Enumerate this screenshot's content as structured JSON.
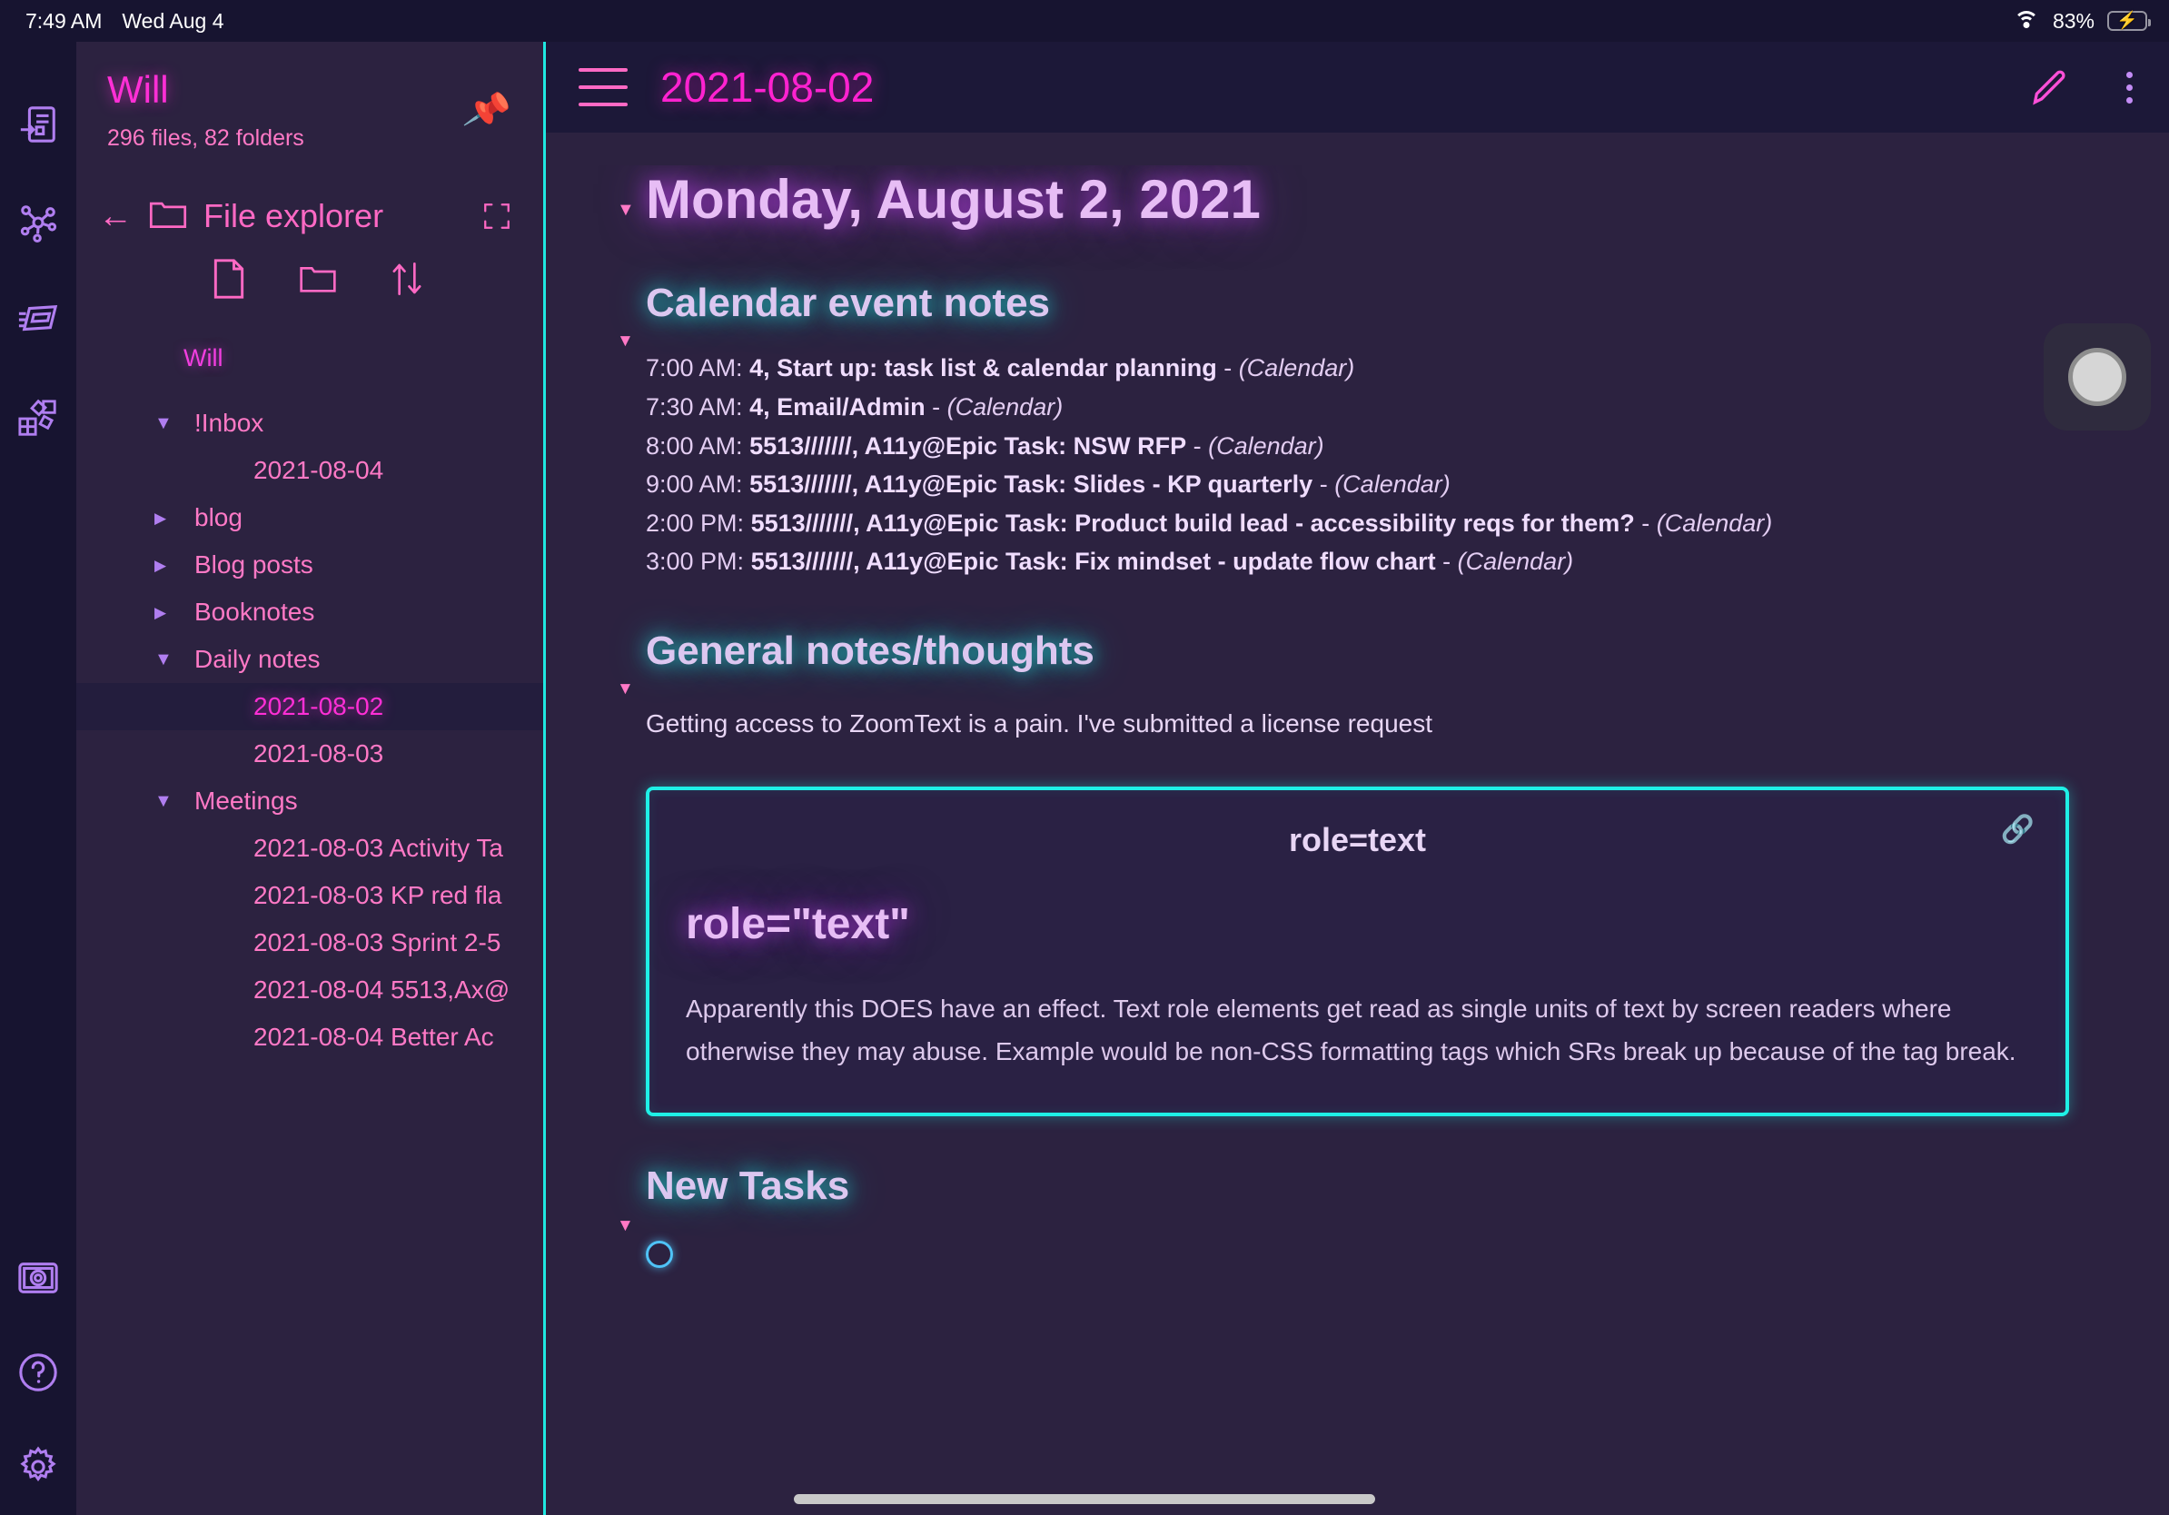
{
  "status_bar": {
    "time": "7:49 AM",
    "date": "Wed Aug 4",
    "wifi_icon": "wifi-icon",
    "battery_percent": "83%",
    "battery_icon": "battery-charging-icon"
  },
  "rail": {
    "items": [
      {
        "icon": "quick-switcher-icon",
        "label": "Open quick switcher"
      },
      {
        "icon": "graph-view-icon",
        "label": "Open graph view"
      },
      {
        "icon": "slides-icon",
        "label": "Start presentation"
      },
      {
        "icon": "plugins-icon",
        "label": "Open plugins"
      }
    ],
    "bottom_items": [
      {
        "icon": "vault-icon",
        "label": "Open another vault"
      },
      {
        "icon": "help-icon",
        "label": "Help"
      },
      {
        "icon": "settings-gear-icon",
        "label": "Settings"
      }
    ]
  },
  "sidebar": {
    "vault_name": "Will",
    "vault_stats": "296 files, 82 folders",
    "pin_icon": "pin-icon",
    "explorer": {
      "back_icon": "back-arrow-icon",
      "folder_icon": "folder-icon",
      "title": "File explorer",
      "fullscreen_icon": "expand-icon",
      "actions": [
        {
          "icon": "new-note-icon",
          "label": "New note"
        },
        {
          "icon": "new-folder-icon",
          "label": "New folder"
        },
        {
          "icon": "sort-icon",
          "label": "Change sort order"
        }
      ]
    },
    "tree_root": "Will",
    "tree": [
      {
        "type": "folder",
        "label": "!Inbox",
        "state": "open"
      },
      {
        "type": "file",
        "label": "2021-08-04"
      },
      {
        "type": "folder",
        "label": "blog",
        "state": "closed"
      },
      {
        "type": "folder",
        "label": "Blog posts",
        "state": "closed"
      },
      {
        "type": "folder",
        "label": "Booknotes",
        "state": "closed"
      },
      {
        "type": "folder",
        "label": "Daily notes",
        "state": "open"
      },
      {
        "type": "file",
        "label": "2021-08-02",
        "active": true
      },
      {
        "type": "file",
        "label": "2021-08-03"
      },
      {
        "type": "folder",
        "label": "Meetings",
        "state": "open"
      },
      {
        "type": "file",
        "label": "2021-08-03 Activity Ta"
      },
      {
        "type": "file",
        "label": "2021-08-03 KP red fla"
      },
      {
        "type": "file",
        "label": "2021-08-03 Sprint 2-5"
      },
      {
        "type": "file",
        "label": "2021-08-04 5513,Ax@"
      },
      {
        "type": "file",
        "label": "2021-08-04 Better Ac"
      }
    ]
  },
  "main": {
    "hamburger_icon": "menu-icon",
    "note_title": "2021-08-02",
    "edit_icon": "pencil-icon",
    "more_icon": "more-options-icon",
    "heading_1": "Monday, August 2, 2021",
    "section_calendar": "Calendar event notes",
    "calendar_events": [
      {
        "time": "7:00 AM: ",
        "title": "4, Start up: task list & calendar planning",
        "source": "(Calendar)"
      },
      {
        "time": "7:30 AM: ",
        "title": "4, Email/Admin",
        "source": "(Calendar)"
      },
      {
        "time": "8:00 AM: ",
        "title": "5513///////, A11y@Epic Task: NSW RFP",
        "source": "(Calendar)"
      },
      {
        "time": "9:00 AM: ",
        "title": "5513///////, A11y@Epic Task: Slides - KP quarterly",
        "source": "(Calendar)"
      },
      {
        "time": "2:00 PM: ",
        "title": "5513///////, A11y@Epic Task: Product build lead - accessibility reqs for them?",
        "source": "(Calendar)"
      },
      {
        "time": "3:00 PM: ",
        "title": "5513///////, A11y@Epic Task: Fix mindset - update flow chart",
        "source": "(Calendar)"
      }
    ],
    "section_general": "General notes/thoughts",
    "general_paragraph": "Getting access to ZoomText is a pain. I've submitted a license request",
    "embed": {
      "title": "role=text",
      "link_icon": "link-icon",
      "heading": "role=\"text\"",
      "body": "Apparently this DOES have an effect. Text role elements get read as single units of text by screen readers where otherwise they may abuse. Example would be non-CSS formatting tags which SRs break up because of the tag break."
    },
    "section_tasks": "New Tasks",
    "first_task": ""
  },
  "assistive_touch": {
    "icon": "assistive-touch-button"
  },
  "colors": {
    "accent_pink": "#ff2fd6",
    "accent_cyan": "#1ff0e6",
    "accent_purple": "#b07ef0",
    "sidebar_bg": "#2c2240",
    "rail_bg": "#171430",
    "battery_green": "#30d158"
  }
}
